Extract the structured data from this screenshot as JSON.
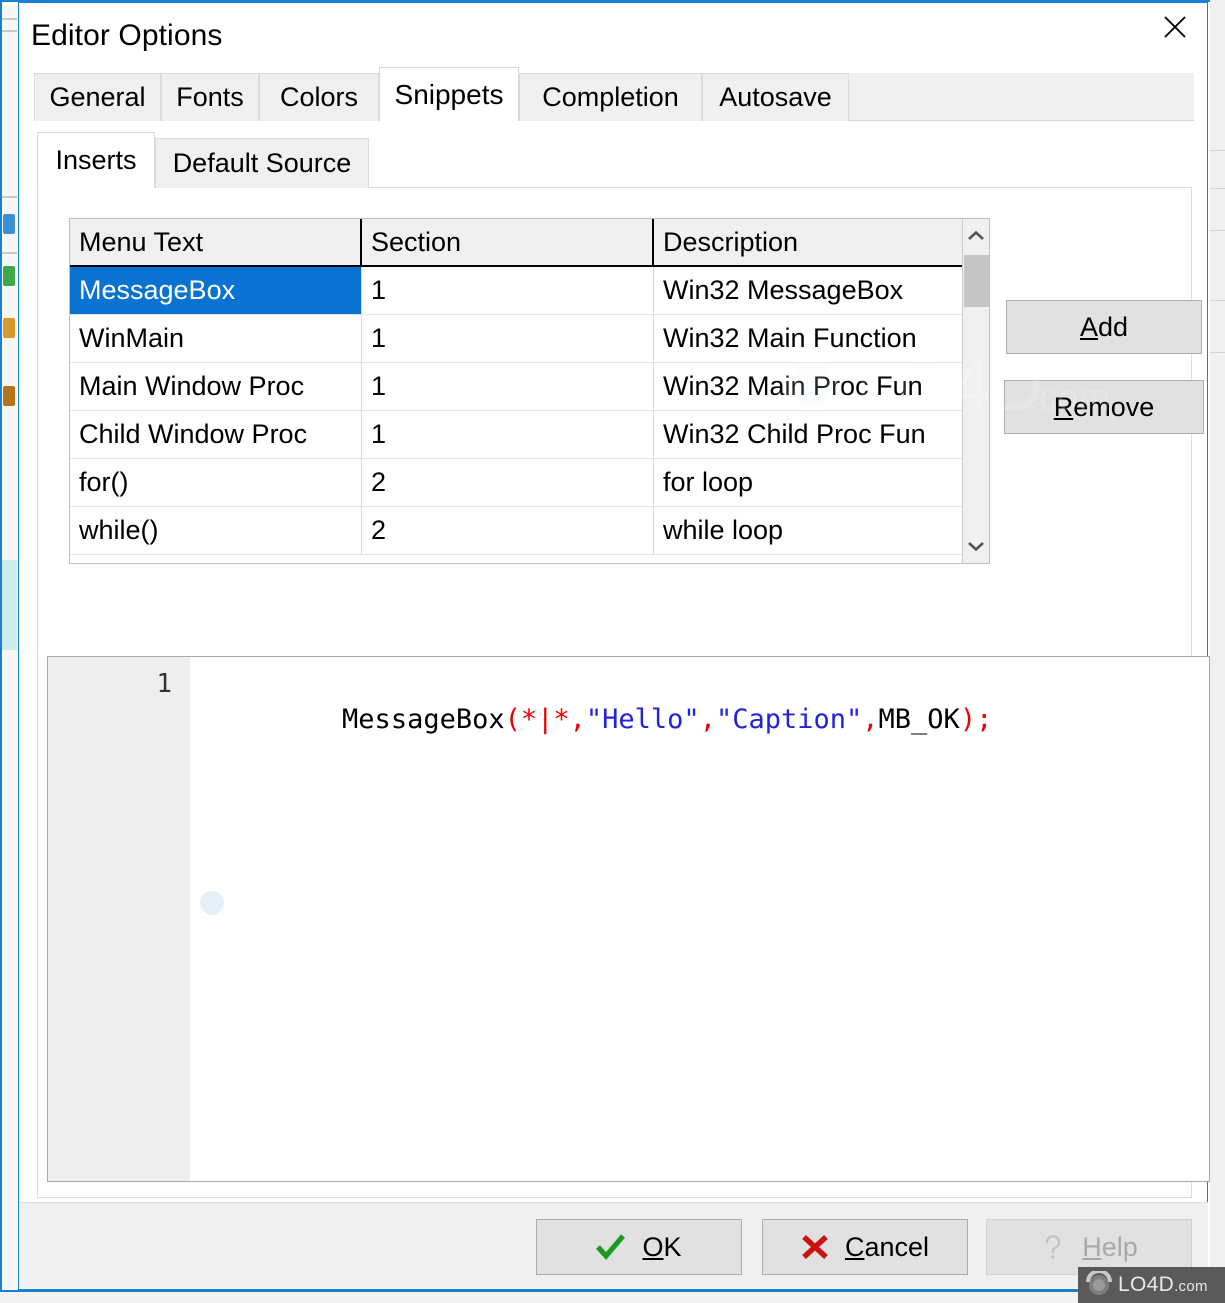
{
  "window": {
    "title": "Editor Options",
    "close_icon": "close-icon"
  },
  "outer_tabs": [
    {
      "label": "General",
      "active": false
    },
    {
      "label": "Fonts",
      "active": false
    },
    {
      "label": "Colors",
      "active": false
    },
    {
      "label": "Snippets",
      "active": true
    },
    {
      "label": "Completion",
      "active": false
    },
    {
      "label": "Autosave",
      "active": false
    }
  ],
  "inner_tabs": [
    {
      "label": "Inserts",
      "active": true
    },
    {
      "label": "Default Source",
      "active": false
    }
  ],
  "snippet_table": {
    "columns": [
      "Menu Text",
      "Section",
      "Description"
    ],
    "rows": [
      {
        "menu_text": "MessageBox",
        "section": "1",
        "description": "Win32 MessageBox",
        "selected": true
      },
      {
        "menu_text": "WinMain",
        "section": "1",
        "description": "Win32 Main Function",
        "selected": false
      },
      {
        "menu_text": "Main Window Proc",
        "section": "1",
        "description": "Win32 Main Proc Fun",
        "selected": false
      },
      {
        "menu_text": "Child Window Proc",
        "section": "1",
        "description": "Win32 Child Proc Fun",
        "selected": false
      },
      {
        "menu_text": "for()",
        "section": "2",
        "description": "for loop",
        "selected": false
      },
      {
        "menu_text": "while()",
        "section": "2",
        "description": "while loop",
        "selected": false
      }
    ],
    "scrollbar": {
      "up_icon": "chevron-up-icon",
      "down_icon": "chevron-down-icon"
    }
  },
  "side_buttons": {
    "add": {
      "accel": "A",
      "rest": "dd"
    },
    "remove": {
      "accel": "R",
      "rest": "emove"
    }
  },
  "editor": {
    "line_number": "1",
    "tokens": [
      {
        "text": "MessageBox",
        "kind": "plain"
      },
      {
        "text": "(*|*,",
        "kind": "punct"
      },
      {
        "text": "\"Hello\"",
        "kind": "string"
      },
      {
        "text": ",",
        "kind": "punct"
      },
      {
        "text": "\"Caption\"",
        "kind": "string"
      },
      {
        "text": ",",
        "kind": "punct"
      },
      {
        "text": "MB_OK",
        "kind": "plain"
      },
      {
        "text": ");",
        "kind": "punct"
      }
    ]
  },
  "footer_buttons": {
    "ok": {
      "accel": "O",
      "rest": "K",
      "icon": "check-icon",
      "icon_color": "#1a9c21",
      "enabled": true
    },
    "cancel": {
      "accel": "C",
      "rest": "ancel",
      "icon": "cross-icon",
      "icon_color": "#cc1111",
      "enabled": true
    },
    "help": {
      "accel": "H",
      "rest": "elp",
      "icon": "question-icon",
      "icon_color": "#bdbdbd",
      "enabled": false
    }
  },
  "watermark": {
    "brand": "LO4D",
    "suffix": ".com"
  },
  "colors": {
    "window_border": "#1a7fd4",
    "selection": "#0a72d0",
    "button_face": "#e1e1e1",
    "tab_face": "#f0f0f0",
    "code_punct": "#ee0000",
    "code_string": "#2222dd",
    "code_plain": "#000000"
  }
}
